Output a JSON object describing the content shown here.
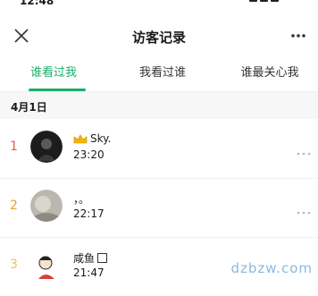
{
  "status_bar": {
    "time": "12:48"
  },
  "navbar": {
    "title": "访客记录"
  },
  "tabs": [
    {
      "label": "谁看过我",
      "active": true
    },
    {
      "label": "我看过谁",
      "active": false
    },
    {
      "label": "谁最关心我",
      "active": false
    }
  ],
  "date_group": {
    "label": "4月1日"
  },
  "visitors": [
    {
      "rank": "1",
      "name": "Sky.",
      "time": "23:20",
      "badge": "crown-icon",
      "rank_color": "#e85a4f"
    },
    {
      "rank": "2",
      "name": "，。",
      "time": "22:17",
      "rank_color": "#f0a020"
    },
    {
      "rank": "3",
      "name": "咸鱼",
      "time": "21:47",
      "suffix_icon": "box-icon",
      "rank_color": "#f5c242"
    }
  ],
  "watermark": "dzbzw.com",
  "colors": {
    "accent": "#1aad6b",
    "rank1": "#e85a4f",
    "rank2": "#f0a020",
    "rank3": "#f5c242"
  }
}
